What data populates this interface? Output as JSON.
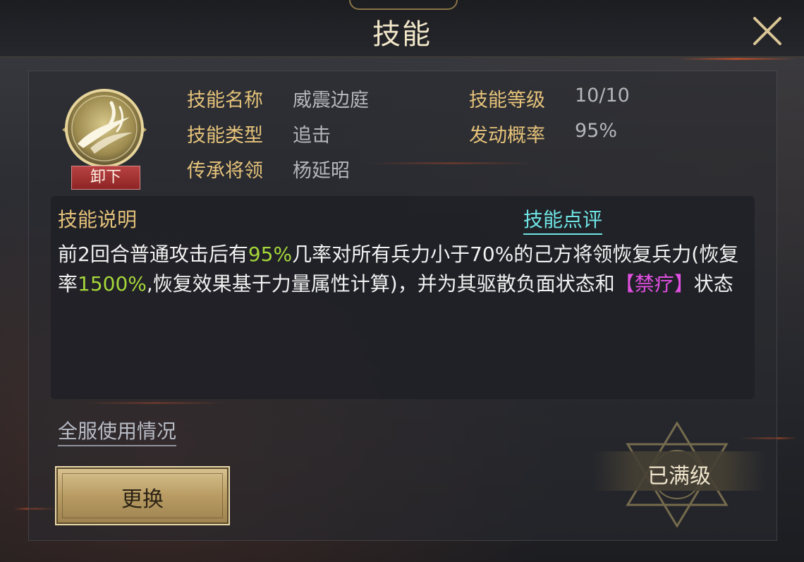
{
  "header": {
    "title": "技能"
  },
  "skill": {
    "unequip_label": "卸下",
    "rows": {
      "name_label": "技能名称",
      "name_value": "威震边庭",
      "level_label": "技能等级",
      "level_value": "10/10",
      "type_label": "技能类型",
      "type_value": "追击",
      "chance_label": "发动概率",
      "chance_value": "95%",
      "inherit_label": "传承将领",
      "inherit_value": "杨延昭"
    }
  },
  "description": {
    "title": "技能说明",
    "review_link": "技能点评",
    "parts": {
      "p1": "前2回合普通攻击后有",
      "p2": "95%",
      "p3": "几率对所有兵力小于70%的己方将领恢复兵力(恢复率",
      "p4": "1500%",
      "p5": ",恢复效果基于力量属性计算)，并为其驱散负面状态和",
      "p6": "【禁疗】",
      "p7": "状态"
    }
  },
  "footer": {
    "usage_link": "全服使用情况",
    "change_button": "更换",
    "maxed_label": "已满级"
  },
  "colors": {
    "gold_label": "#e5c27a",
    "highlight_green": "#a5d63a",
    "highlight_purple": "#e04fe0",
    "link_cyan": "#6fe4e4",
    "unequip_red": "#b84242"
  }
}
